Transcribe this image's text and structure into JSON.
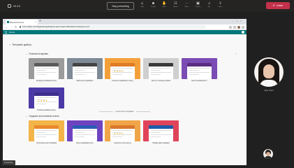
{
  "meeting": {
    "duration": "04:10",
    "share_label": "Stop presenting",
    "tools": [
      {
        "glyph": "☺",
        "label": "Chat",
        "icon": "chat-icon"
      },
      {
        "glyph": "☻",
        "label": "People",
        "icon": "people-icon"
      },
      {
        "glyph": "✋",
        "label": "Raise",
        "icon": "raise-hand-icon"
      },
      {
        "glyph": "☷",
        "label": "Rooms",
        "icon": "rooms-icon"
      },
      {
        "glyph": "⋯",
        "label": "More",
        "icon": "more-icon"
      },
      {
        "glyph": "▣",
        "label": "Camera",
        "icon": "camera-icon"
      },
      {
        "glyph": "♫",
        "label": "Mic",
        "icon": "mic-icon"
      },
      {
        "glyph": "⇪",
        "label": "Share",
        "icon": "share-icon"
      }
    ],
    "leave_label": "Leave",
    "presenter_badge": "Presenting",
    "participants": [
      {
        "name": "Jane Chen"
      }
    ]
  },
  "browser": {
    "tab_title": "Microsoft Forms",
    "url": "forms.office.com/Pages/DesignPageV2.aspx?origin=OfficeDotCom&lang=en-US",
    "app_name": "Forms"
  },
  "gallery": {
    "back_label": "Template gallery",
    "section1": "Featured templates",
    "section2": "Organize and schedule events",
    "load_more": "Load more templates",
    "featured": [
      {
        "title": "Employee feedback survey",
        "header": "#5b5b5b",
        "bg": "#9b9b9b"
      },
      {
        "title": "Staff event registration",
        "header": "#444444",
        "bg": "#7e8a96"
      },
      {
        "title": "Customer satisfaction survey",
        "header": "#e07b26",
        "bg": "#f4a03a"
      },
      {
        "title": "Quiz on company policies",
        "header": "#3a3a3a",
        "bg": "#cfcfcf"
      },
      {
        "title": "Event feedback form",
        "header": "#5a2d82",
        "bg": "#7a4cb4"
      },
      {
        "title": "Product feedback survey",
        "header": "#3d2e8c",
        "bg": "#4b3aa6"
      }
    ],
    "events": [
      {
        "title": "Community event feedback",
        "header": "#e88a2c",
        "bg": "#f3b44a"
      },
      {
        "title": "Event registration form",
        "header": "#2d5bb5",
        "bg": "#6f43c0"
      },
      {
        "title": "Customer event survey",
        "header": "#d9782b",
        "bg": "#f0a548"
      },
      {
        "title": "Holiday party feedback",
        "header": "#1f5aa8",
        "bg": "#e0445a"
      }
    ]
  }
}
